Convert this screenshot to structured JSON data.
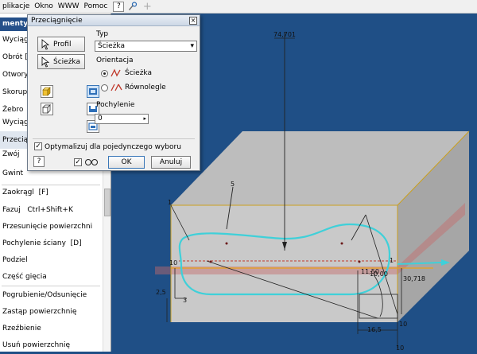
{
  "menubar": {
    "items": [
      "plikacje",
      "Okno",
      "WWW",
      "Pomoc"
    ]
  },
  "left_panel": {
    "header": "menty c",
    "items": [
      {
        "label": "Wyciągnij",
        "key": ""
      },
      {
        "label": "Obrót",
        "key": "[R"
      },
      {
        "label": "Otwory",
        "key": ""
      },
      {
        "label": "Skorupa",
        "key": ""
      },
      {
        "label": "Żebro",
        "key": ""
      },
      {
        "label": "Wyciągnij",
        "key": ""
      },
      {
        "label": "Przeciągn",
        "key": ""
      },
      {
        "label": "Zwój",
        "key": ""
      },
      {
        "label": "Gwint",
        "key": ""
      },
      {
        "label": "Zaokrągl",
        "key": "[F]"
      },
      {
        "label": "Fazuj",
        "key": "Ctrl+Shift+K"
      },
      {
        "label": "Przesunięcie powierzchni",
        "key": ""
      },
      {
        "label": "Pochylenie ściany",
        "key": "[D]"
      },
      {
        "label": "Podziel",
        "key": ""
      },
      {
        "label": "Część gięcia",
        "key": ""
      },
      {
        "label": "Pogrubienie/Odsunięcie",
        "key": ""
      },
      {
        "label": "Zastąp powierzchnię",
        "key": ""
      },
      {
        "label": "Rzeźbienie",
        "key": ""
      },
      {
        "label": "Usuń powierzchnię",
        "key": ""
      }
    ]
  },
  "dialog": {
    "title": "Przeciągnięcie",
    "profile_label": "Profil",
    "path_label": "Ścieżka",
    "type_label": "Typ",
    "type_value": "Ścieżka",
    "orientation_label": "Orientacja",
    "orientation_options": [
      "Ścieżka",
      "Równolegle"
    ],
    "taper_label": "Pochylenie",
    "taper_value": "0",
    "optimize_label": "Optymalizuj dla pojedynczego wyboru",
    "ok_label": "OK",
    "cancel_label": "Anuluj"
  },
  "viewport": {
    "dimensions": [
      "74,701",
      "5",
      "1",
      "1",
      "10",
      "2,5",
      "3",
      "30,718",
      "11,50",
      "10,00",
      "16,5",
      "10",
      "10"
    ]
  },
  "colors": {
    "viewport_bg": "#1f4f86",
    "panel_header": "#25508a",
    "path_curve": "#3fd0d9",
    "dimension_line": "#222222"
  }
}
